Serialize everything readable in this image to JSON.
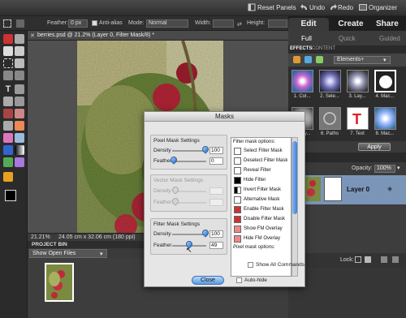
{
  "topbar": {
    "reset_panels": "Reset Panels",
    "undo": "Undo",
    "redo": "Redo",
    "organizer": "Organizer"
  },
  "options": {
    "feather_label": "Feather:",
    "feather_value": "0 px",
    "antialias_label": "Anti-alias",
    "mode_label": "Mode:",
    "mode_value": "Normal",
    "width_label": "Width:",
    "height_label": "Height:"
  },
  "modes": {
    "edit": "Edit",
    "create": "Create",
    "share": "Share"
  },
  "subtabs": {
    "full": "Full",
    "quick": "Quick",
    "guided": "Guided"
  },
  "document": {
    "tab_title": "berries.psd @ 21.2% (Layer 0, Filter Mask/8) *",
    "zoom": "21.21%",
    "doc_size": "24.05 cm x 32.06 cm (180 ppi)"
  },
  "project_bin": {
    "title": "PROJECT BIN",
    "select_value": "Show Open Files"
  },
  "effects": {
    "tab_effects": "EFFECTS",
    "tab_content": "CONTENT",
    "category": "Elements+",
    "thumbs": [
      {
        "label": "1. Col..."
      },
      {
        "label": "2. Sele..."
      },
      {
        "label": "3. Lay..."
      },
      {
        "label": "4. Mac..."
      },
      {
        "label": "5. Lay..."
      },
      {
        "label": "6. Paths"
      },
      {
        "label": "7. Text"
      },
      {
        "label": "8. Mac..."
      }
    ],
    "apply": "Apply"
  },
  "layers": {
    "opacity_label": "Opacity:",
    "opacity_value": "100%",
    "layer_name": "Layer 0",
    "lock_label": "Lock:"
  },
  "dialog": {
    "title": "Masks",
    "pixel_title": "Pixel Mask Settings",
    "pixel_density_label": "Density",
    "pixel_density_value": "100",
    "pixel_feather_label": "Feather",
    "pixel_feather_value": "0",
    "vector_title": "Vector Mask Settings",
    "vector_density_label": "Density",
    "vector_feather_label": "Feather",
    "filter_title": "Filter Mask Settings",
    "filter_density_label": "Density",
    "filter_density_value": "100",
    "filter_feather_label": "Feather",
    "filter_feather_value": "49",
    "options_title": "Filter mask options:",
    "options": [
      "Select Filter Mask",
      "Deselect Filter Mask",
      "Reveal Filter",
      "Hide Filter",
      "Invert Filter Mask",
      "Alternative Mask",
      "Enable Filter Mask",
      "Disable Filter Mask",
      "Show FM Overlay",
      "Hide FM Overlay",
      "Pixel mask options:"
    ],
    "show_all": "Show All Commands",
    "auto_hide": "Auto-hide",
    "close": "Close"
  }
}
